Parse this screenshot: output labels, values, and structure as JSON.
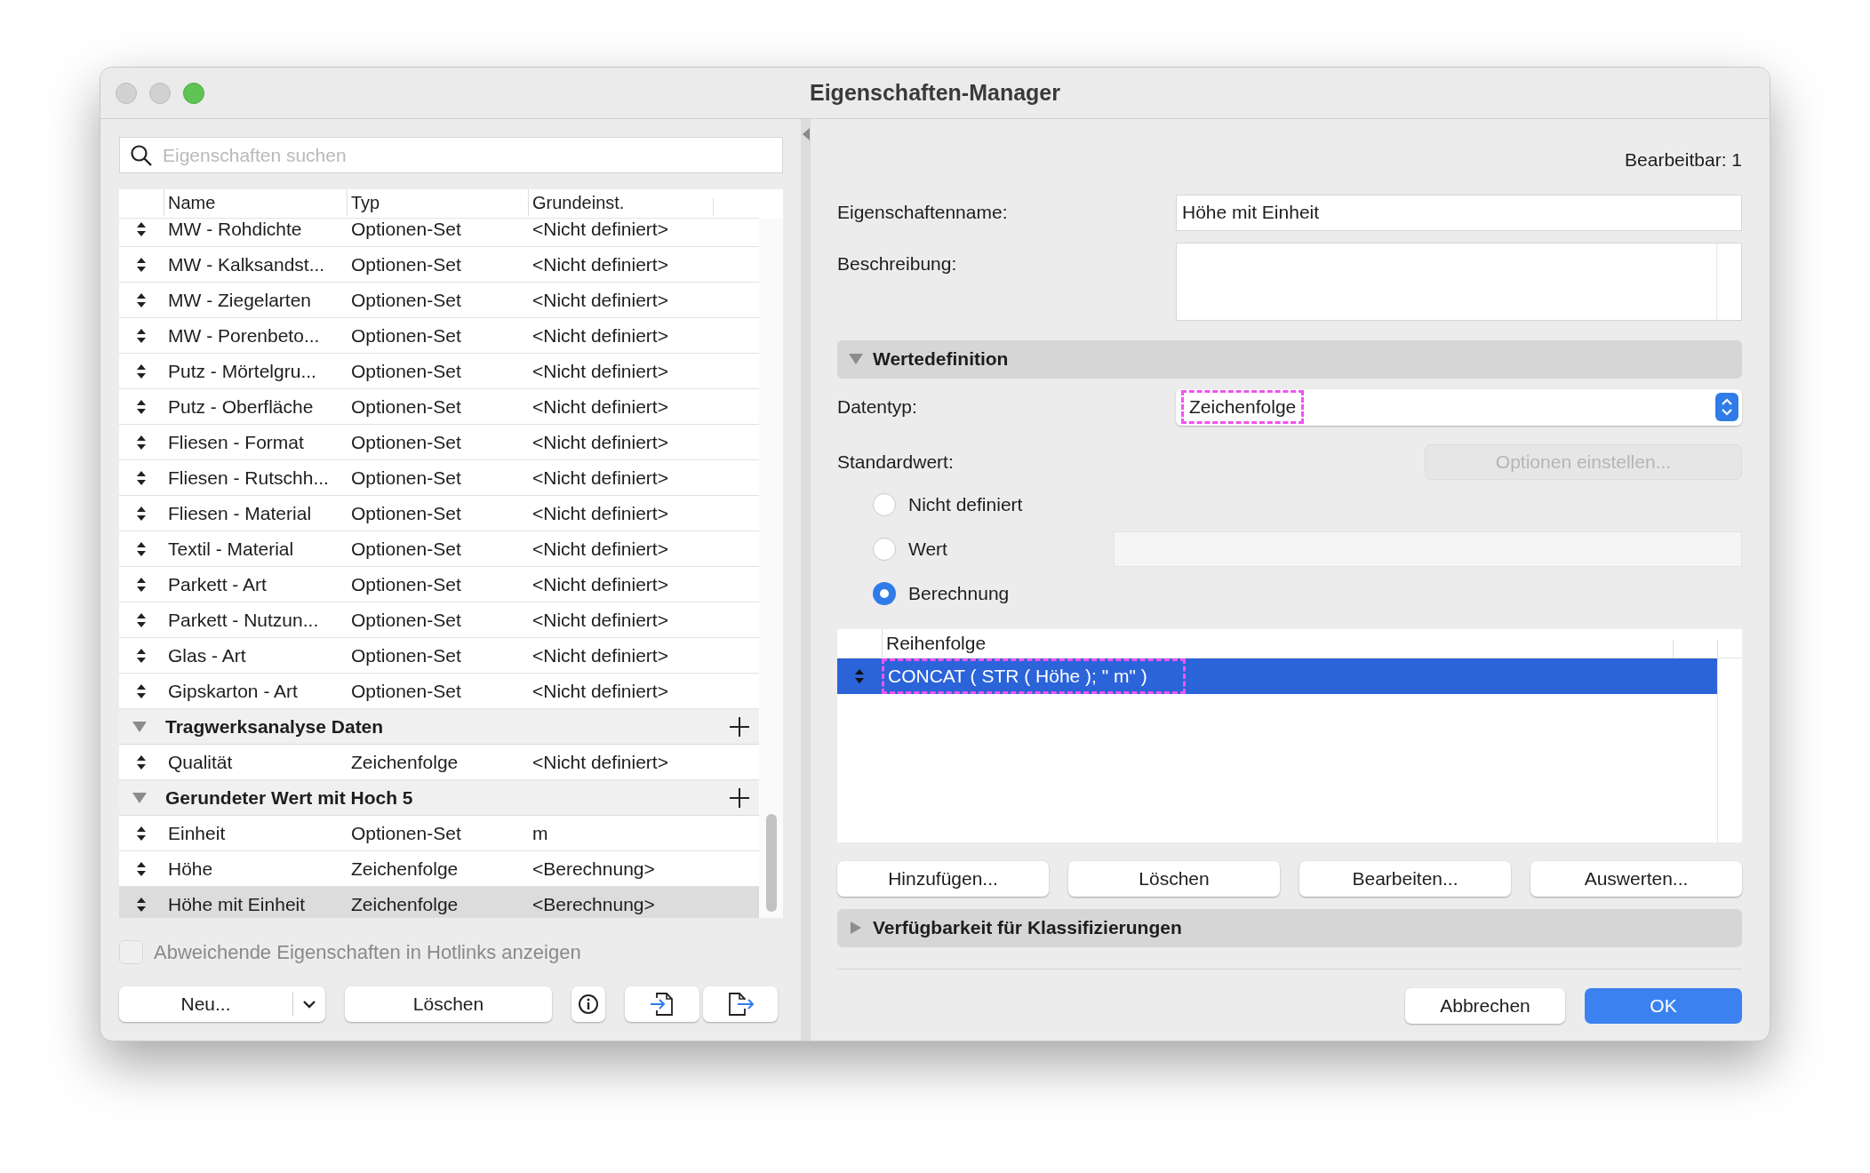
{
  "window": {
    "title": "Eigenschaften-Manager"
  },
  "search": {
    "placeholder": "Eigenschaften suchen"
  },
  "table": {
    "columns": [
      "Name",
      "Typ",
      "Grundeinst."
    ],
    "rows": [
      {
        "kind": "item",
        "name": "MW - Rohdichte",
        "type": "Optionen-Set",
        "default": "<Nicht definiert>",
        "selected": false
      },
      {
        "kind": "item",
        "name": "MW - Kalksandst...",
        "type": "Optionen-Set",
        "default": "<Nicht definiert>",
        "selected": false
      },
      {
        "kind": "item",
        "name": "MW - Ziegelarten",
        "type": "Optionen-Set",
        "default": "<Nicht definiert>",
        "selected": false
      },
      {
        "kind": "item",
        "name": "MW - Porenbeto...",
        "type": "Optionen-Set",
        "default": "<Nicht definiert>",
        "selected": false
      },
      {
        "kind": "item",
        "name": "Putz - Mörtelgru...",
        "type": "Optionen-Set",
        "default": "<Nicht definiert>",
        "selected": false
      },
      {
        "kind": "item",
        "name": "Putz - Oberfläche",
        "type": "Optionen-Set",
        "default": "<Nicht definiert>",
        "selected": false
      },
      {
        "kind": "item",
        "name": "Fliesen - Format",
        "type": "Optionen-Set",
        "default": "<Nicht definiert>",
        "selected": false
      },
      {
        "kind": "item",
        "name": "Fliesen - Rutschh...",
        "type": "Optionen-Set",
        "default": "<Nicht definiert>",
        "selected": false
      },
      {
        "kind": "item",
        "name": "Fliesen - Material",
        "type": "Optionen-Set",
        "default": "<Nicht definiert>",
        "selected": false
      },
      {
        "kind": "item",
        "name": "Textil - Material",
        "type": "Optionen-Set",
        "default": "<Nicht definiert>",
        "selected": false
      },
      {
        "kind": "item",
        "name": "Parkett - Art",
        "type": "Optionen-Set",
        "default": "<Nicht definiert>",
        "selected": false
      },
      {
        "kind": "item",
        "name": "Parkett - Nutzun...",
        "type": "Optionen-Set",
        "default": "<Nicht definiert>",
        "selected": false
      },
      {
        "kind": "item",
        "name": "Glas - Art",
        "type": "Optionen-Set",
        "default": "<Nicht definiert>",
        "selected": false
      },
      {
        "kind": "item",
        "name": "Gipskarton - Art",
        "type": "Optionen-Set",
        "default": "<Nicht definiert>",
        "selected": false
      },
      {
        "kind": "group",
        "name": "Tragwerksanalyse Daten",
        "expanded": true
      },
      {
        "kind": "item",
        "name": "Qualität",
        "type": "Zeichenfolge",
        "default": "<Nicht definiert>",
        "selected": false
      },
      {
        "kind": "group",
        "name": "Gerundeter Wert mit Hoch 5",
        "expanded": true
      },
      {
        "kind": "item",
        "name": "Einheit",
        "type": "Optionen-Set",
        "default": "m",
        "selected": false
      },
      {
        "kind": "item",
        "name": "Höhe",
        "type": "Zeichenfolge",
        "default": "<Berechnung>",
        "selected": false
      },
      {
        "kind": "item",
        "name": "Höhe mit Einheit",
        "type": "Zeichenfolge",
        "default": "<Berechnung>",
        "selected": true
      }
    ]
  },
  "hotlinks_checkbox": {
    "label": "Abweichende Eigenschaften in Hotlinks anzeigen",
    "checked": false,
    "disabled": true
  },
  "left_buttons": {
    "new": "Neu...",
    "delete": "Löschen"
  },
  "editable": "Bearbeitbar: 1",
  "property_name": {
    "label": "Eigenschaftenname:",
    "value": "Höhe mit Einheit"
  },
  "description": {
    "label": "Beschreibung:"
  },
  "value_definition": {
    "title": "Wertedefinition",
    "expanded": true,
    "datatype": {
      "label": "Datentyp:",
      "value": "Zeichenfolge",
      "highlighted": true
    },
    "default_value": {
      "label": "Standardwert:",
      "options_button": "Optionen einstellen..."
    },
    "radios": [
      {
        "label": "Nicht definiert",
        "selected": false
      },
      {
        "label": "Wert",
        "selected": false
      },
      {
        "label": "Berechnung",
        "selected": true
      }
    ],
    "formula_table": {
      "column": "Reihenfolge",
      "rows": [
        {
          "text": "CONCAT ( STR ( Höhe ); \" m\" )",
          "selected": true,
          "highlighted": true
        }
      ]
    },
    "buttons": [
      "Hinzufügen...",
      "Löschen",
      "Bearbeiten...",
      "Auswerten..."
    ]
  },
  "classification": {
    "title": "Verfügbarkeit für Klassifizierungen",
    "expanded": false
  },
  "footer_buttons": [
    {
      "label": "Abbrechen",
      "kind": "secondary"
    },
    {
      "label": "OK",
      "kind": "primary"
    }
  ]
}
